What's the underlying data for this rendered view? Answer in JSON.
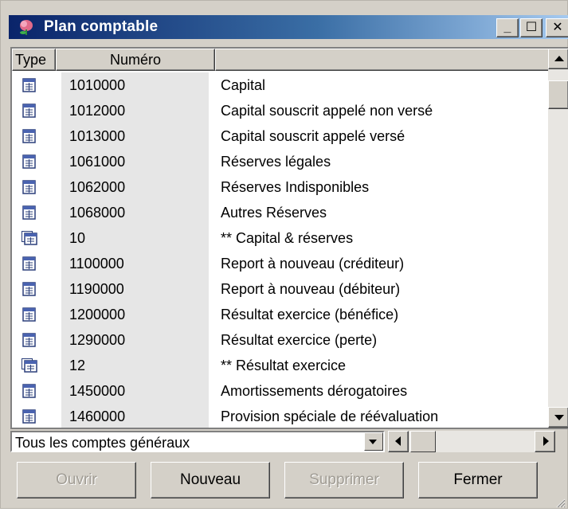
{
  "window": {
    "title": "Plan comptable",
    "icon": "flower-app-icon",
    "controls": {
      "minimize": "_",
      "maximize": "☐",
      "close": "✕"
    }
  },
  "columns": {
    "type": "Type",
    "numero": "Numéro",
    "description": ""
  },
  "rows": [
    {
      "type_icon": "account-icon",
      "numero": "1010000",
      "label": "Capital"
    },
    {
      "type_icon": "account-icon",
      "numero": "1012000",
      "label": "Capital souscrit appelé non versé"
    },
    {
      "type_icon": "account-icon",
      "numero": "1013000",
      "label": "Capital souscrit appelé versé"
    },
    {
      "type_icon": "account-icon",
      "numero": "1061000",
      "label": "Réserves légales"
    },
    {
      "type_icon": "account-icon",
      "numero": "1062000",
      "label": "Réserves Indisponibles"
    },
    {
      "type_icon": "account-icon",
      "numero": "1068000",
      "label": "Autres Réserves"
    },
    {
      "type_icon": "account-group-icon",
      "numero": "10",
      "label": "** Capital & réserves"
    },
    {
      "type_icon": "account-icon",
      "numero": "1100000",
      "label": "Report à nouveau (créditeur)"
    },
    {
      "type_icon": "account-icon",
      "numero": "1190000",
      "label": "Report à nouveau (débiteur)"
    },
    {
      "type_icon": "account-icon",
      "numero": "1200000",
      "label": "Résultat exercice (bénéfice)"
    },
    {
      "type_icon": "account-icon",
      "numero": "1290000",
      "label": "Résultat exercice (perte)"
    },
    {
      "type_icon": "account-group-icon",
      "numero": "12",
      "label": "** Résultat exercice"
    },
    {
      "type_icon": "account-icon",
      "numero": "1450000",
      "label": "Amortissements dérogatoires"
    },
    {
      "type_icon": "account-icon",
      "numero": "1460000",
      "label": "Provision spéciale de réévaluation"
    }
  ],
  "filter": {
    "selected": "Tous les comptes généraux"
  },
  "buttons": {
    "ouvrir": "Ouvrir",
    "nouveau": "Nouveau",
    "supprimer": "Supprimer",
    "fermer": "Fermer"
  },
  "colors": {
    "title_start": "#0a246a",
    "title_end": "#a6caf0",
    "face": "#d4d0c8",
    "numero_bg": "#e6e6e6"
  }
}
